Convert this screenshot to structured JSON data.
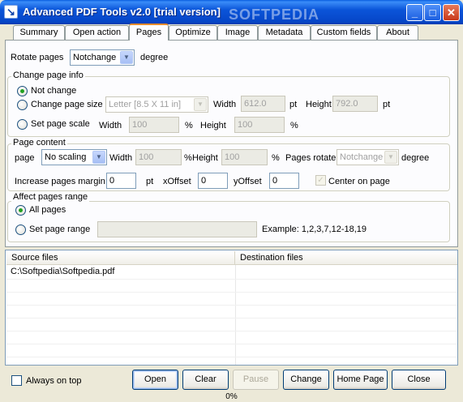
{
  "window": {
    "title": "Advanced PDF Tools  v2.0 [trial version]",
    "minimize": "_",
    "maximize": "□",
    "close": "✕"
  },
  "tabs": [
    "Summary",
    "Open action",
    "Pages",
    "Optimize",
    "Image",
    "Metadata",
    "Custom fields",
    "About"
  ],
  "active_tab": "Pages",
  "pages": {
    "rotate_label": "Rotate pages",
    "rotate_value": "Notchange",
    "rotate_unit": "degree",
    "change_info": {
      "legend": "Change page info",
      "not_change": "Not change",
      "change_size": "Change page size",
      "size_value": "Letter [8.5 X 11 in]",
      "width_label": "Width",
      "width_value": "612.0",
      "pt1": "pt",
      "height_label": "Height",
      "height_value": "792.0",
      "pt2": "pt",
      "set_scale": "Set page scale",
      "scale_width_label": "Width",
      "scale_width_value": "100",
      "pct1": "%",
      "scale_height_label": "Height",
      "scale_height_value": "100",
      "pct2": "%"
    },
    "content": {
      "legend": "Page content",
      "page_label": "page",
      "page_value": "No scaling",
      "width_label": "Width",
      "width_value": "100",
      "pct1": "%",
      "height_label": "Height",
      "height_value": "100",
      "pct2": "%",
      "rotate_label": "Pages rotate",
      "rotate_value": "Notchange",
      "rotate_unit": "degree",
      "margin_label": "Increase pages margin",
      "margin_value": "0",
      "margin_unit": "pt",
      "xoffset_label": "xOffset",
      "xoffset_value": "0",
      "yoffset_label": "yOffset",
      "yoffset_value": "0",
      "center_label": "Center on page"
    },
    "range": {
      "legend": "Affect pages range",
      "all_pages": "All pages",
      "set_range": "Set page range",
      "range_value": "",
      "example": "Example: 1,2,3,7,12-18,19"
    }
  },
  "files": {
    "source_header": "Source files",
    "dest_header": "Destination files",
    "rows": [
      {
        "source": "C:\\Softpedia\\Softpedia.pdf",
        "dest": ""
      }
    ]
  },
  "bottom": {
    "always_on_top": "Always on top",
    "open": "Open",
    "clear": "Clear",
    "pause": "Pause",
    "change": "Change",
    "home_page": "Home Page",
    "close": "Close"
  },
  "status": {
    "progress": "0%"
  },
  "watermark": "SOFTPEDIA",
  "colors": {
    "titlebar": "#0b55d9",
    "window_bg": "#ece9d8",
    "active_tab_accent": "#e68b2c",
    "radio_dot": "#21a121"
  }
}
